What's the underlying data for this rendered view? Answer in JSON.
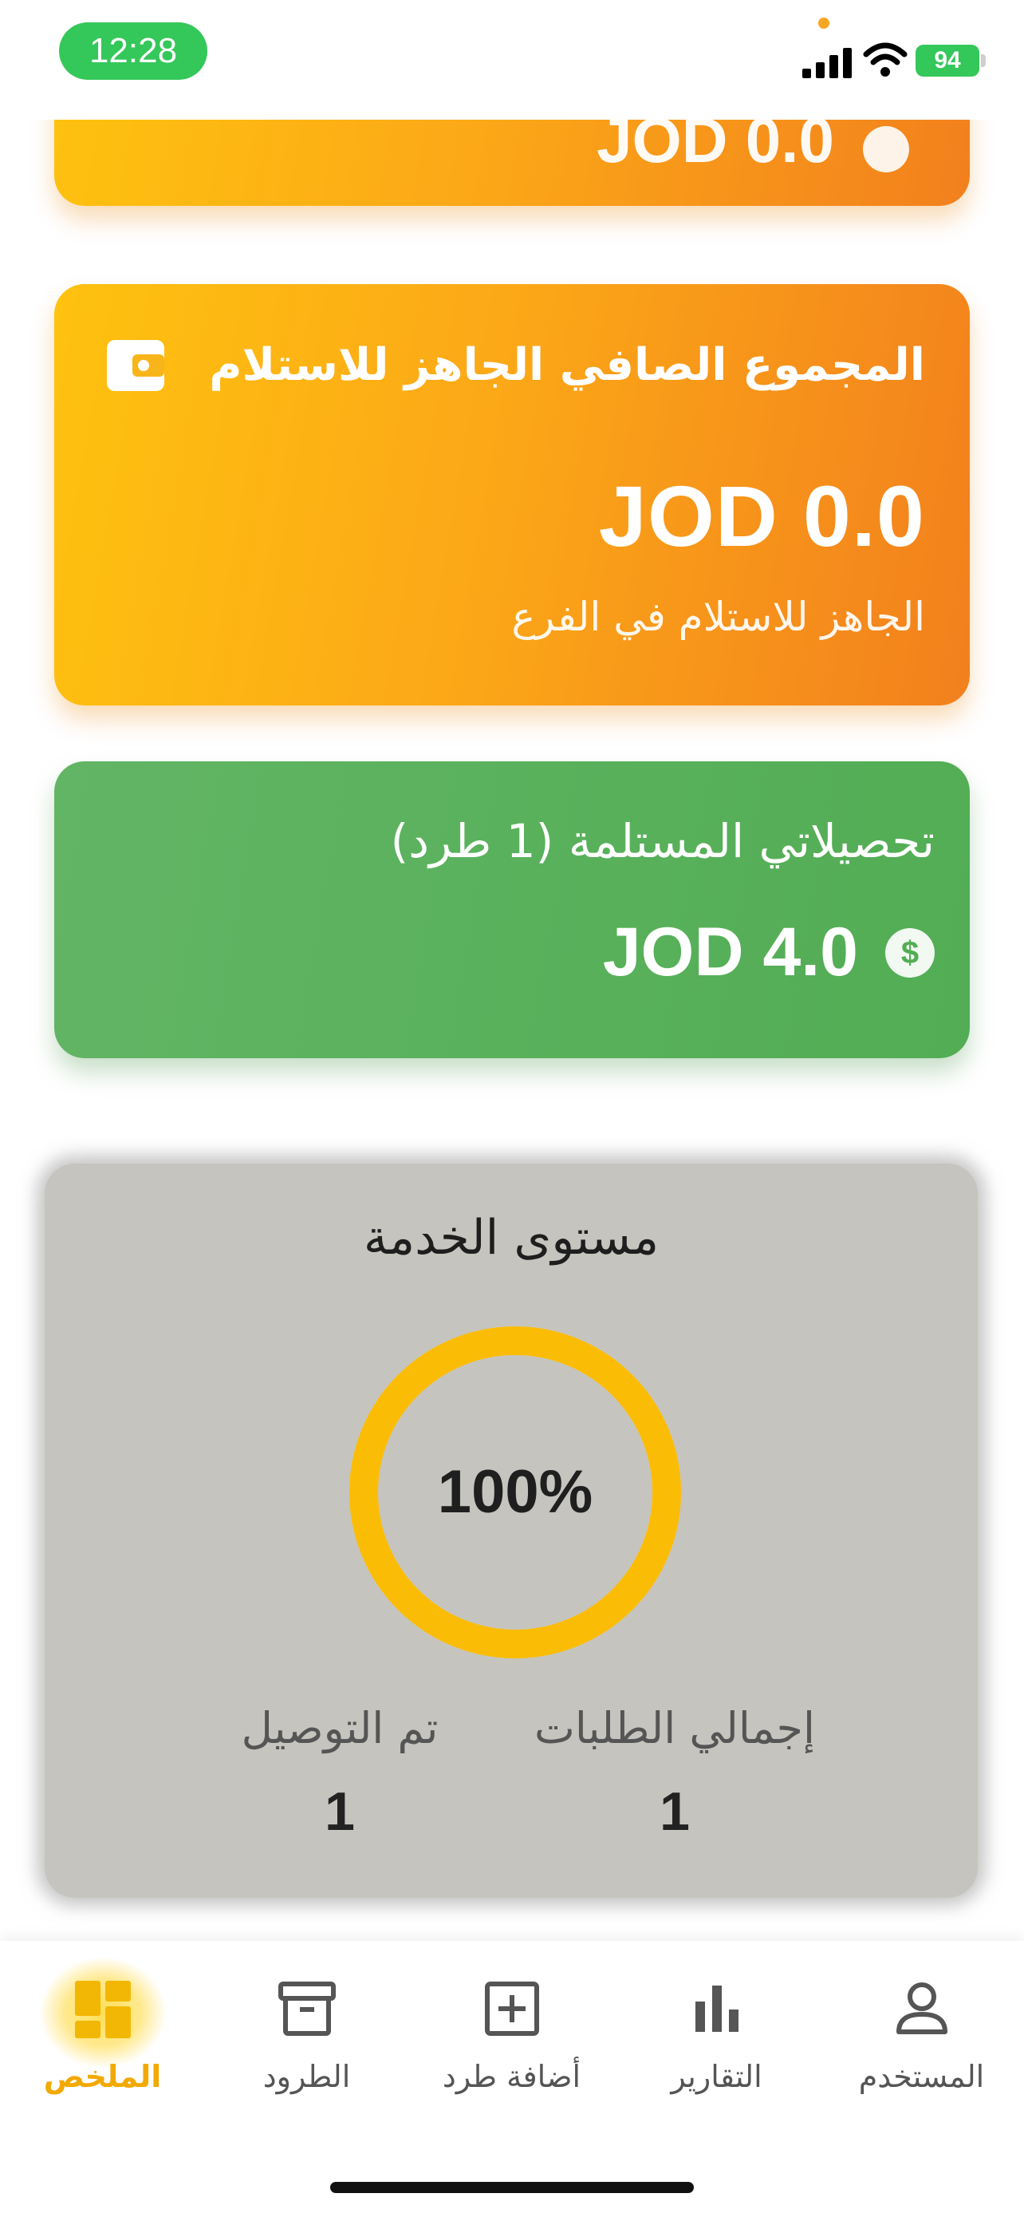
{
  "status_bar": {
    "time": "12:28",
    "battery": "94"
  },
  "cards": {
    "top_partial": {
      "amount": "JOD 0.0"
    },
    "ready": {
      "title": "المجموع الصافي الجاهز للاستلام",
      "amount": "JOD 0.0",
      "subtitle": "الجاهز للاستلام في الفرع"
    },
    "collections": {
      "title": "تحصيلاتي المستلمة (1 طرد)",
      "amount": "JOD 4.0",
      "currency_icon": "dollar-circle-icon"
    }
  },
  "service_level": {
    "title": "مستوى الخدمة",
    "percent_label": "100%",
    "percent": 100,
    "total_orders_label": "إجمالي الطلبات",
    "total_orders_value": "1",
    "delivered_label": "تم التوصيل",
    "delivered_value": "1"
  },
  "bottom_nav": {
    "items": [
      {
        "label": "المستخدم",
        "icon": "user-icon"
      },
      {
        "label": "التقارير",
        "icon": "bar-chart-icon"
      },
      {
        "label": "أضافة طرد",
        "icon": "add-box-icon"
      },
      {
        "label": "الطرود",
        "icon": "archive-icon"
      },
      {
        "label": "الملخص",
        "icon": "dashboard-icon",
        "active": true
      }
    ]
  },
  "colors": {
    "accent": "#fcb315",
    "orange_start": "#fec20f",
    "orange_end": "#f2801d",
    "green": "#52ad54",
    "ring": "#fbbc05",
    "panel": "#c5c4be"
  }
}
